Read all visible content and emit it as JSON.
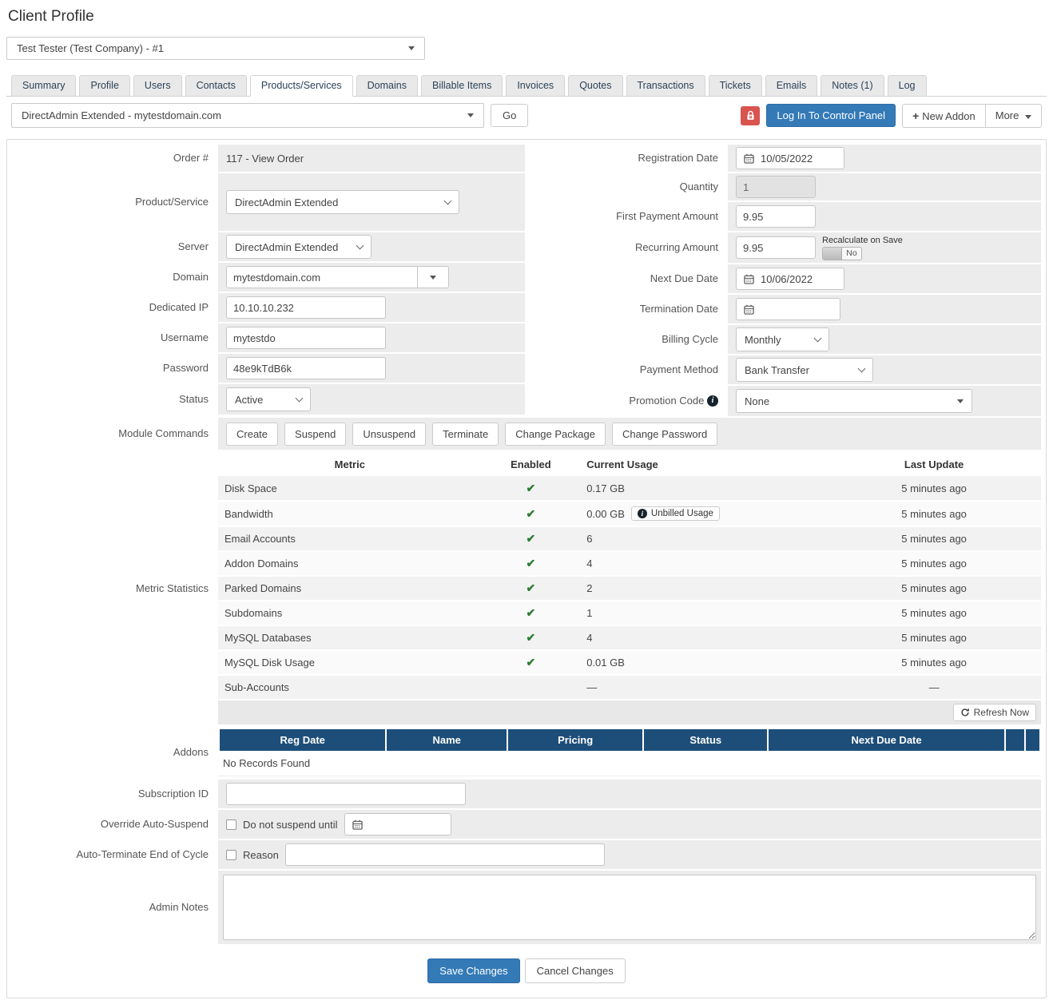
{
  "page": {
    "title": "Client Profile"
  },
  "client_selector": {
    "value": "Test Tester (Test Company) - #1"
  },
  "tabs": [
    {
      "label": "Summary"
    },
    {
      "label": "Profile"
    },
    {
      "label": "Users"
    },
    {
      "label": "Contacts"
    },
    {
      "label": "Products/Services"
    },
    {
      "label": "Domains"
    },
    {
      "label": "Billable Items"
    },
    {
      "label": "Invoices"
    },
    {
      "label": "Quotes"
    },
    {
      "label": "Transactions"
    },
    {
      "label": "Tickets"
    },
    {
      "label": "Emails"
    },
    {
      "label": "Notes (1)"
    },
    {
      "label": "Log"
    }
  ],
  "toolbar": {
    "product_selector": "DirectAdmin Extended - mytestdomain.com",
    "go_label": "Go",
    "login_label": "Log In To Control Panel",
    "new_addon_label": "New Addon",
    "more_label": "More"
  },
  "form": {
    "order": {
      "label": "Order #",
      "value": "117 - View Order"
    },
    "product_service": {
      "label": "Product/Service",
      "value": "DirectAdmin Extended"
    },
    "server": {
      "label": "Server",
      "value": "DirectAdmin Extended"
    },
    "domain": {
      "label": "Domain",
      "value": "mytestdomain.com"
    },
    "dedicated_ip": {
      "label": "Dedicated IP",
      "value": "10.10.10.232"
    },
    "username": {
      "label": "Username",
      "value": "mytestdo"
    },
    "password": {
      "label": "Password",
      "value": "48e9kTdB6k"
    },
    "status": {
      "label": "Status",
      "value": "Active"
    },
    "module_commands": {
      "label": "Module Commands",
      "buttons": [
        "Create",
        "Suspend",
        "Unsuspend",
        "Terminate",
        "Change Package",
        "Change Password"
      ]
    },
    "registration_date": {
      "label": "Registration Date",
      "value": "10/05/2022"
    },
    "quantity": {
      "label": "Quantity",
      "value": "1"
    },
    "first_payment": {
      "label": "First Payment Amount",
      "value": "9.95"
    },
    "recurring": {
      "label": "Recurring Amount",
      "value": "9.95",
      "recalc_label": "Recalculate on Save",
      "recalc_value": "No"
    },
    "next_due": {
      "label": "Next Due Date",
      "value": "10/06/2022"
    },
    "termination": {
      "label": "Termination Date",
      "value": ""
    },
    "billing_cycle": {
      "label": "Billing Cycle",
      "value": "Monthly"
    },
    "payment_method": {
      "label": "Payment Method",
      "value": "Bank Transfer"
    },
    "promotion": {
      "label": "Promotion Code",
      "value": "None"
    }
  },
  "metrics": {
    "label": "Metric Statistics",
    "columns": [
      "Metric",
      "Enabled",
      "Current Usage",
      "Last Update"
    ],
    "rows": [
      {
        "name": "Disk Space",
        "enabled": true,
        "usage": "0.17 GB",
        "updated": "5 minutes ago"
      },
      {
        "name": "Bandwidth",
        "enabled": true,
        "usage": "0.00 GB",
        "badge": "Unbilled Usage",
        "updated": "5 minutes ago"
      },
      {
        "name": "Email Accounts",
        "enabled": true,
        "usage": "6",
        "updated": "5 minutes ago"
      },
      {
        "name": "Addon Domains",
        "enabled": true,
        "usage": "4",
        "updated": "5 minutes ago"
      },
      {
        "name": "Parked Domains",
        "enabled": true,
        "usage": "2",
        "updated": "5 minutes ago"
      },
      {
        "name": "Subdomains",
        "enabled": true,
        "usage": "1",
        "updated": "5 minutes ago"
      },
      {
        "name": "MySQL Databases",
        "enabled": true,
        "usage": "4",
        "updated": "5 minutes ago"
      },
      {
        "name": "MySQL Disk Usage",
        "enabled": true,
        "usage": "0.01 GB",
        "updated": "5 minutes ago"
      },
      {
        "name": "Sub-Accounts",
        "enabled": false,
        "usage": "—",
        "updated": "—"
      }
    ],
    "refresh_label": "Refresh Now"
  },
  "addons": {
    "label": "Addons",
    "columns": [
      "Reg Date",
      "Name",
      "Pricing",
      "Status",
      "Next Due Date"
    ],
    "empty_text": "No Records Found"
  },
  "bottom": {
    "subscription": {
      "label": "Subscription ID",
      "value": ""
    },
    "override_suspend": {
      "label": "Override Auto-Suspend",
      "checkbox_label": "Do not suspend until"
    },
    "auto_terminate": {
      "label": "Auto-Terminate End of Cycle",
      "checkbox_label": "Reason"
    },
    "admin_notes": {
      "label": "Admin Notes",
      "value": ""
    }
  },
  "actions": {
    "save_label": "Save Changes",
    "cancel_label": "Cancel Changes"
  },
  "icons": {
    "check": "✔"
  },
  "colors": {
    "primary": "#337ab7",
    "table_header": "#1d4e79",
    "danger": "#d9534f",
    "check_green": "#2e7d32"
  }
}
